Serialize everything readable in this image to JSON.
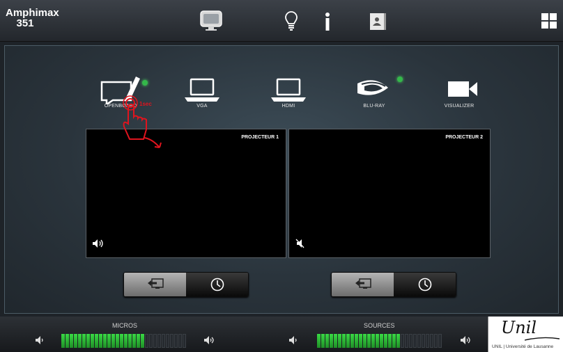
{
  "room": {
    "line1": "Amphimax",
    "line2": "351"
  },
  "topbar": {
    "icons": [
      "display-icon",
      "bulb-icon",
      "info-icon",
      "contacts-icon",
      "grid-icon"
    ]
  },
  "sources": [
    {
      "label": "OPENBOARD",
      "icon": "whiteboard-pen-icon",
      "active": true
    },
    {
      "label": "VGA",
      "icon": "laptop-icon",
      "active": false
    },
    {
      "label": "HDMI",
      "icon": "laptop-icon",
      "active": false
    },
    {
      "label": "BLU-RAY",
      "icon": "bluray-icon",
      "active": true
    },
    {
      "label": "VISUALIZER",
      "icon": "camera-icon",
      "active": false
    }
  ],
  "projectors": [
    {
      "title": "PROJECTEUR 1",
      "audio": "on"
    },
    {
      "title": "PROJECTEUR 2",
      "audio": "muted"
    }
  ],
  "hint": {
    "text": "1sec"
  },
  "bottom": {
    "micros": {
      "label": "MICROS",
      "level_segments_on": 20,
      "total_segments": 30
    },
    "sources": {
      "label": "SOURCES",
      "level_segments_on": 20,
      "total_segments": 30
    }
  },
  "logo": {
    "script": "Unil",
    "tagline": "UNIL | Université de Lausanne"
  },
  "colors": {
    "accent_green": "#34b84a",
    "hint_red": "#e0141e"
  }
}
